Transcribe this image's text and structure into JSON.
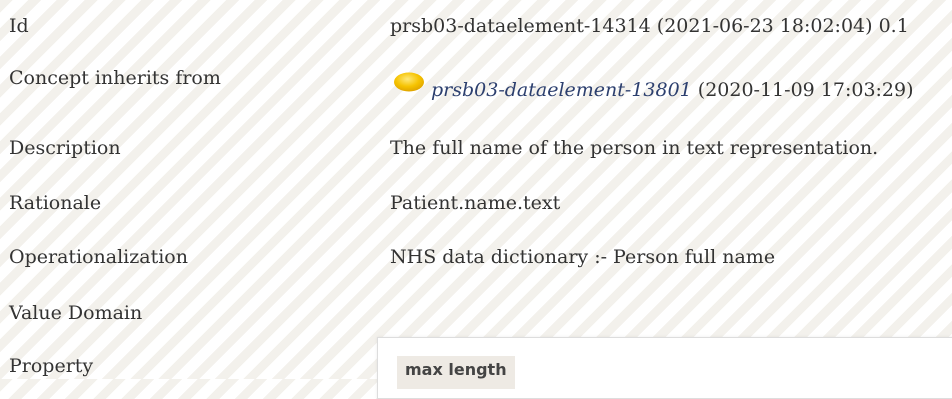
{
  "fields": {
    "id": {
      "label": "Id",
      "value": "prsb03-dataelement-14314 (2021-06-23 18:02:04) 0.1"
    },
    "inherits": {
      "label": "Concept inherits from",
      "link": "prsb03-dataelement-13801",
      "date": "(2020-11-09 17:03:29)",
      "icon": "status-dot-icon",
      "icon_color": "#f6c300"
    },
    "description": {
      "label": "Description",
      "value": "The full name of the person in text representation."
    },
    "rationale": {
      "label": "Rationale",
      "value": "Patient.name.text"
    },
    "operationalization": {
      "label": "Operationalization",
      "value": "NHS data dictionary :- Person full name"
    },
    "value_domain": {
      "label": "Value Domain"
    },
    "property": {
      "label": "Property",
      "chip": "max length"
    }
  }
}
